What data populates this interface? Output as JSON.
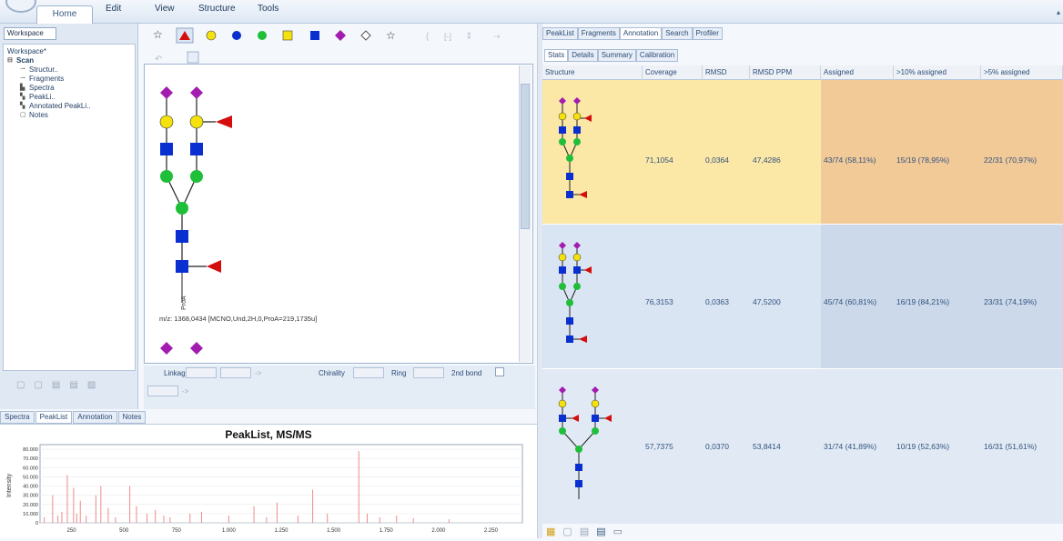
{
  "menu": {
    "home": "Home",
    "edit": "Edit",
    "view": "View",
    "structure": "Structure",
    "tools": "Tools"
  },
  "workspace": {
    "tab": "Workspace",
    "root": "Workspace*",
    "scan": "Scan",
    "items": [
      "Structur..",
      "Fragments",
      "Spectra",
      "PeakLi..",
      "Annotated PeakLi..",
      "Notes"
    ]
  },
  "bottom_tabs": [
    "Spectra",
    "PeakList",
    "Annotation",
    "Notes"
  ],
  "peaklist_chart": {
    "title": "PeakList, MS/MS",
    "ylabel": "Intensity",
    "yticks": [
      "80.000",
      "70.000",
      "60.000",
      "50.000",
      "40.000",
      "30.000",
      "20.000",
      "10.000",
      "0"
    ],
    "xticks": [
      "250",
      "500",
      "750",
      "1.000",
      "1.250",
      "1.500",
      "1.750",
      "2.000",
      "2.250"
    ]
  },
  "chart_data": {
    "type": "bar",
    "title": "PeakList, MS/MS",
    "ylabel": "Intensity",
    "ylim": [
      0,
      85000
    ],
    "xlim": [
      100,
      2400
    ],
    "x": [
      120,
      160,
      185,
      204,
      230,
      260,
      275,
      292,
      320,
      366,
      390,
      425,
      460,
      528,
      560,
      610,
      650,
      690,
      720,
      815,
      870,
      1000,
      1120,
      1180,
      1230,
      1330,
      1400,
      1470,
      1620,
      1660,
      1720,
      1800,
      1880,
      2050
    ],
    "values": [
      6000,
      30000,
      8000,
      12000,
      52000,
      38000,
      10000,
      24000,
      8000,
      30000,
      40000,
      16000,
      6000,
      40000,
      18000,
      10000,
      14000,
      8000,
      6000,
      10000,
      12000,
      8000,
      18000,
      6000,
      22000,
      8000,
      36000,
      10000,
      78000,
      10000,
      6000,
      8000,
      5000,
      4000
    ]
  },
  "center": {
    "mz_text": "m/z: 1368,0434 [MCNO,Und,2H,0,ProA=219,1735u]",
    "reducing_end": "ProA",
    "props": {
      "linkage": "Linkage",
      "chirality": "Chirality",
      "ring": "Ring",
      "second_bond": "2nd bond",
      "arrow": "->"
    }
  },
  "right": {
    "top_tabs": [
      "PeakList",
      "Fragments",
      "Annotation",
      "Search",
      "Profiler"
    ],
    "sub_tabs": [
      "Stats",
      "Details",
      "Summary",
      "Calibration"
    ],
    "columns": [
      "Structure",
      "Coverage",
      "RMSD",
      "RMSD PPM",
      "Assigned",
      ">10% assigned",
      ">5% assigned"
    ],
    "rows": [
      {
        "coverage": "71,1054",
        "rmsd": "0,0364",
        "ppm": "47,4286",
        "assigned": "43/74 (58,11%)",
        "ten": "15/19 (78,95%)",
        "five": "22/31 (70,97%)"
      },
      {
        "coverage": "76,3153",
        "rmsd": "0,0363",
        "ppm": "47,5200",
        "assigned": "45/74 (60,81%)",
        "ten": "16/19 (84,21%)",
        "five": "23/31 (74,19%)"
      },
      {
        "coverage": "57,7375",
        "rmsd": "0,0370",
        "ppm": "53,8414",
        "assigned": "31/74 (41,89%)",
        "ten": "10/19 (52,63%)",
        "five": "16/31 (51,61%)"
      }
    ]
  },
  "colors": {
    "sialic": "#a21caf",
    "galactose": "#f5e10c",
    "glcnac": "#0a2fd0",
    "mannose": "#1fbf3a",
    "fucose": "#d40d0d"
  }
}
